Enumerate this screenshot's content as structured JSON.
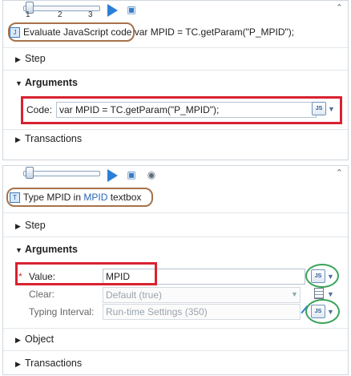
{
  "step1": {
    "slider_ticks": [
      "1",
      "2",
      "3"
    ],
    "description": "Evaluate JavaScript code",
    "description_code": " var MPID = TC.getParam(\"P_MPID\");",
    "sections": {
      "step": "Step",
      "arguments": "Arguments",
      "transactions": "Transactions"
    },
    "code_label": "Code:",
    "code_value": "var MPID = TC.getParam(\"P_MPID\");",
    "js_button": "JS"
  },
  "step2": {
    "description_prefix": "Type MPID in",
    "description_keyword": "MPID",
    "description_suffix": "textbox",
    "sections": {
      "step": "Step",
      "arguments": "Arguments",
      "object": "Object",
      "transactions": "Transactions"
    },
    "required_marker": "*",
    "value_label": "Value:",
    "value_value": "MPID",
    "clear_label": "Clear:",
    "clear_value": "Default (true)",
    "typing_label": "Typing Interval:",
    "typing_value": "Run-time Settings (350)",
    "js_button": "JS"
  },
  "icons": {
    "play": "play-icon",
    "step_settings": "step-settings-icon",
    "collapse": "collapse-up-icon",
    "record": "record-icon"
  },
  "colors": {
    "highlight_red": "#d82230",
    "highlight_brown": "#a7724a",
    "highlight_green": "#3aa35a",
    "accent_blue": "#2d7fd6"
  }
}
